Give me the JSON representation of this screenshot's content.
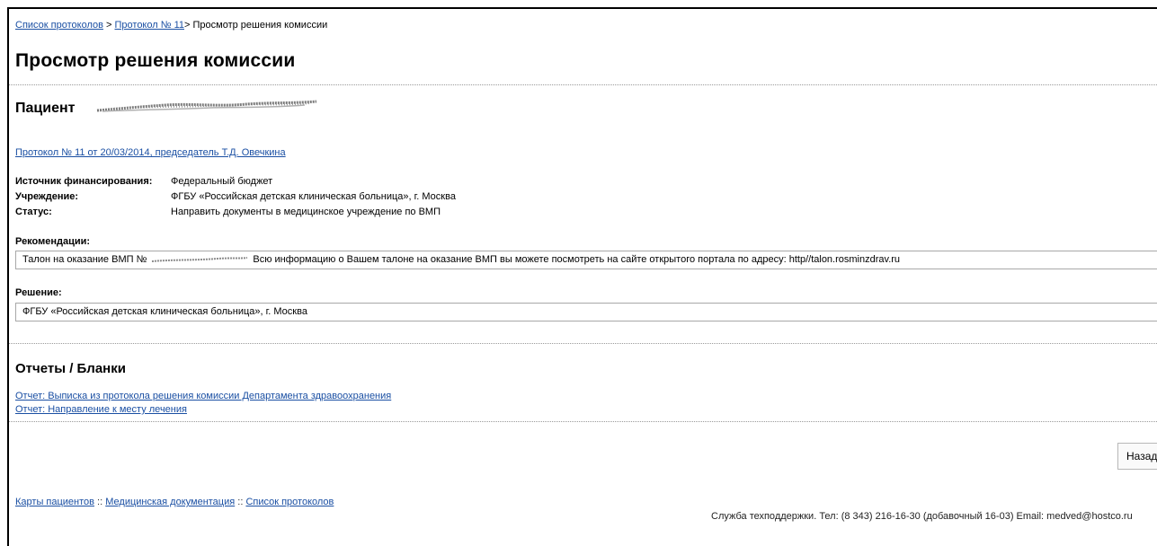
{
  "breadcrumb": {
    "item1": "Список протоколов",
    "sep1": " > ",
    "item2": "Протокол № 11",
    "sep2": "> ",
    "current": "Просмотр решения комиссии"
  },
  "page": {
    "title": "Просмотр решения комиссии"
  },
  "patient": {
    "label": "Пациент"
  },
  "protocol": {
    "link": "Протокол № 11 от 20/03/2014, председатель Т.Д. Овечкина"
  },
  "details": [
    {
      "label": "Источник финансирования:",
      "value": "Федеральный бюджет"
    },
    {
      "label": "Учреждение:",
      "value": "ФГБУ «Российская детская клиническая больница», г. Москва"
    },
    {
      "label": "Статус:",
      "value": "Направить документы в медицинское учреждение по ВМП"
    }
  ],
  "recommendations": {
    "label": "Рекомендации:",
    "prefix": "Талон на оказание ВМП №",
    "suffix": "Всю информацию о Вашем талоне на оказание ВМП вы можете посмотреть на сайте открытого портала по адресу: http//talon.rosminzdrav.ru"
  },
  "decision": {
    "label": "Решение:",
    "value": "ФГБУ «Российская детская клиническая больница», г. Москва"
  },
  "reports": {
    "title": "Отчеты / Бланки",
    "items": [
      "Отчет: Выписка из протокола решения комиссии Департамента здравоохранения",
      "Отчет: Направление к месту лечения"
    ]
  },
  "actions": {
    "back_label": "Назад"
  },
  "footer": {
    "links": [
      "Карты пациентов",
      "Медицинская документация",
      "Список протоколов"
    ],
    "separator": " :: ",
    "support": "Служба техподдержки. Тел: (8 343) 216-16-30 (добавочный 16-03) Email: medved@hostco.ru"
  },
  "colors": {
    "link": "#1a4fa3",
    "divider": "#9a9a9a"
  }
}
